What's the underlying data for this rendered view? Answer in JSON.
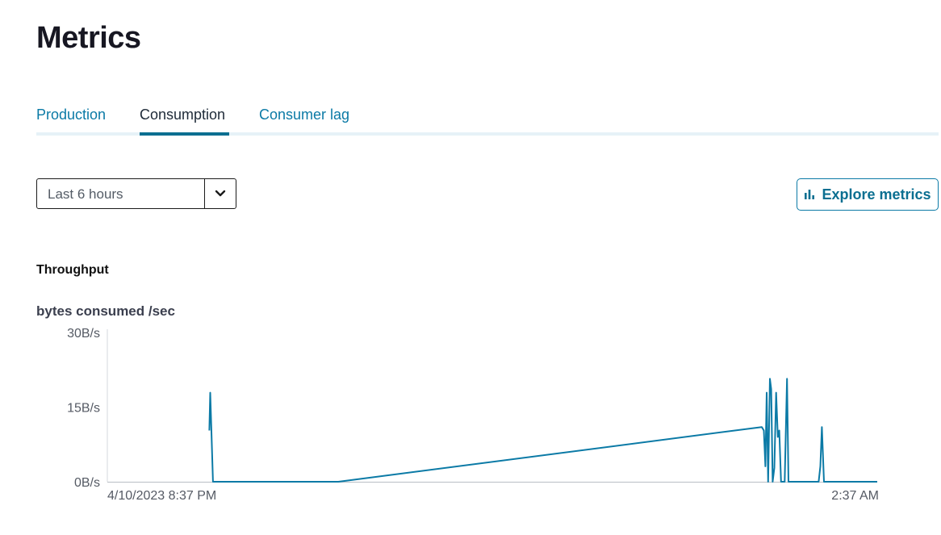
{
  "page": {
    "title": "Metrics"
  },
  "tabs": [
    {
      "label": "Production",
      "active": false
    },
    {
      "label": "Consumption",
      "active": true
    },
    {
      "label": "Consumer lag",
      "active": false
    }
  ],
  "time_range": {
    "selected": "Last 6 hours"
  },
  "explore_button": {
    "label": "Explore metrics",
    "icon": "bar-chart-icon"
  },
  "section": {
    "title": "Throughput"
  },
  "colors": {
    "accent": "#0b7aa6",
    "line": "#0b7aa6",
    "tab_active": "#0b6f91"
  },
  "chart_data": {
    "type": "line",
    "title": "bytes consumed /sec",
    "xlabel": "",
    "ylabel": "",
    "y_ticks": [
      "0B/s",
      "15B/s",
      "30B/s"
    ],
    "x_ticks": [
      "4/10/2023 8:37 PM",
      "2:37 AM"
    ],
    "ylim": [
      0,
      30
    ],
    "x_unit": "minutes",
    "xlim": [
      0,
      360
    ],
    "grid": false,
    "series": [
      {
        "values": [
          [
            47.7,
            10.3
          ],
          [
            48.1,
            17.9
          ],
          [
            49.4,
            0
          ],
          [
            108,
            0
          ],
          [
            306,
            11
          ],
          [
            307,
            10.3
          ],
          [
            307.7,
            3.1
          ],
          [
            308.3,
            17.9
          ],
          [
            309,
            0
          ],
          [
            309.8,
            20.7
          ],
          [
            310.4,
            18.6
          ],
          [
            311.1,
            0
          ],
          [
            311.9,
            2.8
          ],
          [
            312.7,
            17.9
          ],
          [
            313.5,
            9
          ],
          [
            314.2,
            10.3
          ],
          [
            315,
            0
          ],
          [
            316.7,
            0
          ],
          [
            317.8,
            20.7
          ],
          [
            318.5,
            0
          ],
          [
            332.6,
            0
          ],
          [
            333.4,
            3.1
          ],
          [
            334.1,
            11
          ],
          [
            335.1,
            0
          ],
          [
            360,
            0
          ]
        ]
      }
    ]
  }
}
